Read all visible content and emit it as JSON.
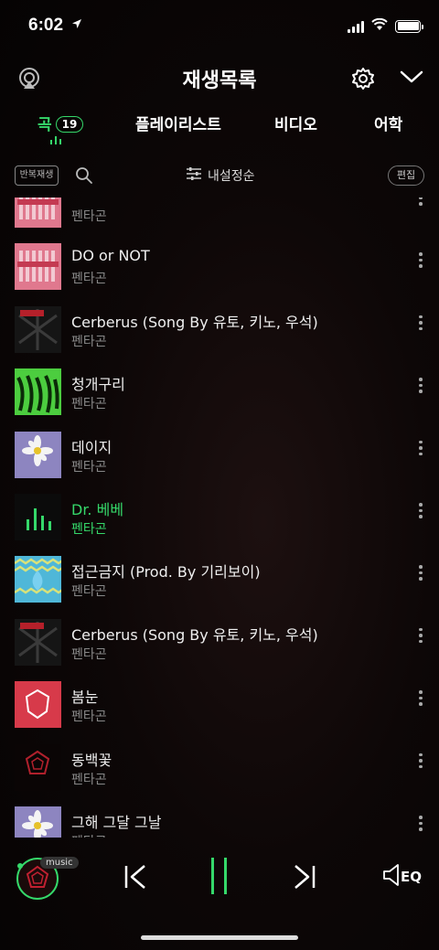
{
  "status_bar": {
    "time": "6:02",
    "location_icon": "location-arrow-icon"
  },
  "header": {
    "title": "재생목록",
    "airplay_icon": "airplay-icon",
    "settings_icon": "gear-icon",
    "collapse_icon": "chevron-down-icon"
  },
  "tabs": [
    {
      "label": "곡",
      "count": "19",
      "active": true
    },
    {
      "label": "플레이리스트"
    },
    {
      "label": "비디오"
    },
    {
      "label": "어학"
    }
  ],
  "toolbar": {
    "repeat_label": "반복재생",
    "sort_label": "내설정순",
    "edit_label": "편집"
  },
  "songs": [
    {
      "title": "",
      "artist": "펜타곤",
      "art": "pink"
    },
    {
      "title": "DO or NOT",
      "artist": "펜타곤",
      "art": "pink"
    },
    {
      "title": "Cerberus (Song By 유토, 키노, 우석)",
      "artist": "펜타곤",
      "art": "dark"
    },
    {
      "title": "청개구리",
      "artist": "펜타곤",
      "art": "green"
    },
    {
      "title": "데이지",
      "artist": "펜타곤",
      "art": "purple"
    },
    {
      "title": "Dr. 베베",
      "artist": "펜타곤",
      "art": "playing",
      "playing": true
    },
    {
      "title": "접근금지 (Prod. By 기리보이)",
      "artist": "펜타곤",
      "art": "blue"
    },
    {
      "title": "Cerberus (Song By 유토, 키노, 우석)",
      "artist": "펜타곤",
      "art": "dark"
    },
    {
      "title": "봄눈",
      "artist": "펜타곤",
      "art": "red"
    },
    {
      "title": "동백꽃",
      "artist": "펜타곤",
      "art": "black"
    },
    {
      "title": "그해 그달 그날",
      "artist": "펜타곤",
      "art": "purple"
    }
  ],
  "player": {
    "badge": "music",
    "eq_label": "EQ"
  },
  "colors": {
    "accent": "#35d86a",
    "background": "#0d0707"
  }
}
